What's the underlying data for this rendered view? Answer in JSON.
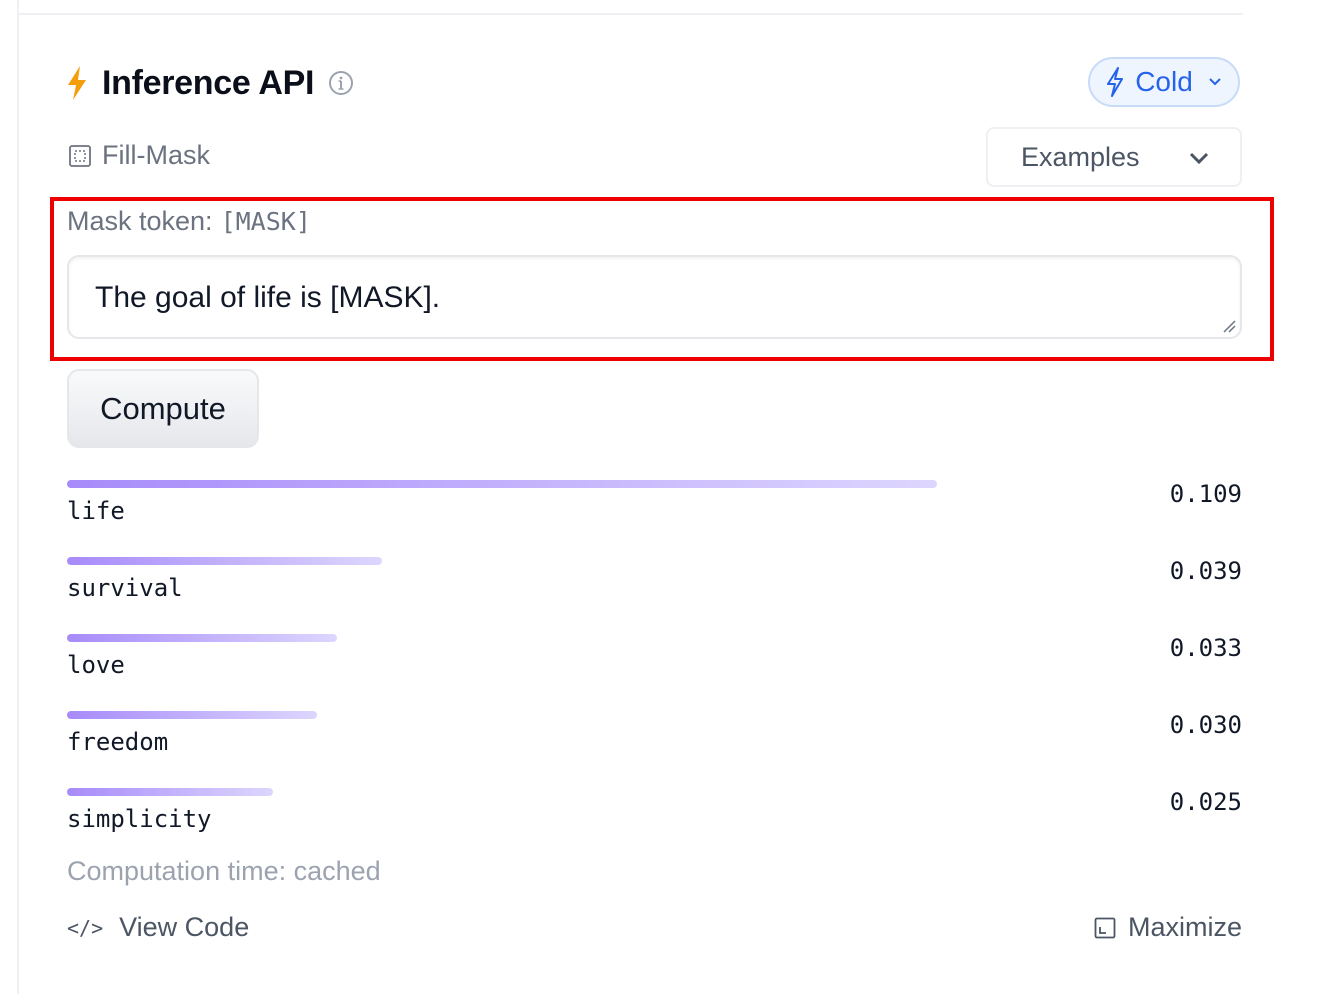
{
  "widget": {
    "title": "Inference API",
    "status": "Cold",
    "task": "Fill-Mask",
    "examples_label": "Examples",
    "mask_label": "Mask token:",
    "mask_token": "[MASK]",
    "input_value": "The goal of life is [MASK].",
    "compute_label": "Compute",
    "computation_time": "Computation time: cached",
    "view_code_label": "View Code",
    "maximize_label": "Maximize"
  },
  "results": [
    {
      "label": "life",
      "score": "0.109",
      "bar_fraction": 0.74
    },
    {
      "label": "survival",
      "score": "0.039",
      "bar_fraction": 0.268
    },
    {
      "label": "love",
      "score": "0.033",
      "bar_fraction": 0.23
    },
    {
      "label": "freedom",
      "score": "0.030",
      "bar_fraction": 0.213
    },
    {
      "label": "simplicity",
      "score": "0.025",
      "bar_fraction": 0.175
    }
  ],
  "colors": {
    "accent_bolt": "#f59e0b",
    "status_blue": "#2563eb",
    "bar_start": "#a78bfa",
    "bar_end": "#ddd6fe",
    "highlight_red": "#ee0000"
  },
  "icons": {
    "header": "lightning-bolt-icon",
    "info": "info-circle-icon",
    "task": "fill-mask-icon",
    "code": "code-brackets-icon",
    "maximize": "maximize-icon"
  }
}
